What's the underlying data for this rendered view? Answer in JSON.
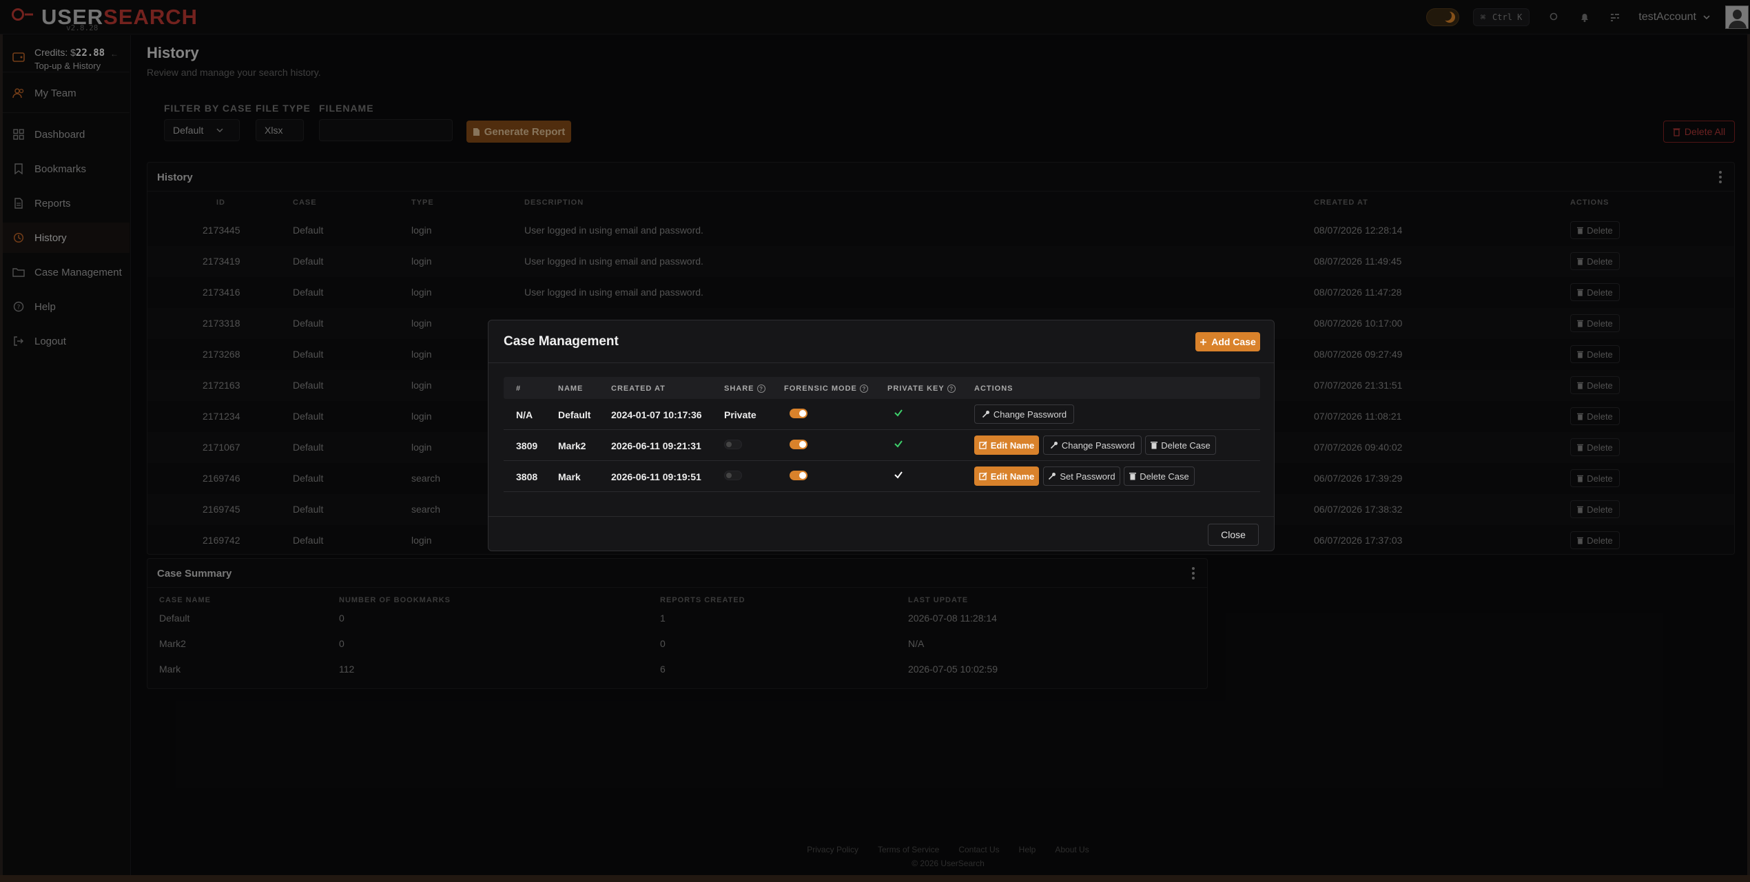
{
  "app": {
    "logo_user": "USER",
    "logo_search": "SEARCH",
    "version": "v2.8.28",
    "shortcut_cmd": "⌘",
    "shortcut_key": "Ctrl K",
    "account_name": "testAccount"
  },
  "sidebar": {
    "credits_label": "Credits: $",
    "credits_value": "22.88",
    "topup_label": "Top-up & History",
    "items": [
      {
        "label": "My Team"
      },
      {
        "label": "Dashboard"
      },
      {
        "label": "Bookmarks"
      },
      {
        "label": "Reports"
      },
      {
        "label": "History"
      },
      {
        "label": "Case Management"
      },
      {
        "label": "Help"
      },
      {
        "label": "Logout"
      }
    ]
  },
  "page": {
    "title": "History",
    "subtitle": "Review and manage your search history."
  },
  "filters": {
    "case_label": "FILTER BY CASE",
    "case_value": "Default",
    "filetype_label": "FILE TYPE",
    "filetype_value": "Xlsx",
    "filename_label": "FILENAME",
    "filename_value": "",
    "generate_label": "Generate Report",
    "delete_all_label": "Delete All"
  },
  "history": {
    "title": "History",
    "columns": [
      "ID",
      "CASE",
      "TYPE",
      "DESCRIPTION",
      "CREATED AT",
      "ACTIONS"
    ],
    "delete_label": "Delete",
    "rows": [
      {
        "id": "2173445",
        "case": "Default",
        "type": "login",
        "description": "User logged in using email and password.",
        "created": "08/07/2026 12:28:14"
      },
      {
        "id": "2173419",
        "case": "Default",
        "type": "login",
        "description": "User logged in using email and password.",
        "created": "08/07/2026 11:49:45"
      },
      {
        "id": "2173416",
        "case": "Default",
        "type": "login",
        "description": "User logged in using email and password.",
        "created": "08/07/2026 11:47:28"
      },
      {
        "id": "2173318",
        "case": "Default",
        "type": "login",
        "description": "",
        "created": "08/07/2026 10:17:00"
      },
      {
        "id": "2173268",
        "case": "Default",
        "type": "login",
        "description": "",
        "created": "08/07/2026 09:27:49"
      },
      {
        "id": "2172163",
        "case": "Default",
        "type": "login",
        "description": "",
        "created": "07/07/2026 21:31:51"
      },
      {
        "id": "2171234",
        "case": "Default",
        "type": "login",
        "description": "",
        "created": "07/07/2026 11:08:21"
      },
      {
        "id": "2171067",
        "case": "Default",
        "type": "login",
        "description": "",
        "created": "07/07/2026 09:40:02"
      },
      {
        "id": "2169746",
        "case": "Default",
        "type": "search",
        "description": "",
        "created": "06/07/2026 17:39:29"
      },
      {
        "id": "2169745",
        "case": "Default",
        "type": "search",
        "description": "",
        "created": "06/07/2026 17:38:32"
      },
      {
        "id": "2169742",
        "case": "Default",
        "type": "login",
        "description": "",
        "created": "06/07/2026 17:37:03"
      }
    ]
  },
  "summary": {
    "title": "Case Summary",
    "columns": [
      "CASE NAME",
      "NUMBER OF BOOKMARKS",
      "REPORTS CREATED",
      "LAST UPDATE"
    ],
    "rows": [
      {
        "name": "Default",
        "bookmarks": "0",
        "reports": "1",
        "last_update": "2026-07-08 11:28:14"
      },
      {
        "name": "Mark2",
        "bookmarks": "0",
        "reports": "0",
        "last_update": "N/A"
      },
      {
        "name": "Mark",
        "bookmarks": "112",
        "reports": "6",
        "last_update": "2026-07-05 10:02:59"
      }
    ]
  },
  "modal": {
    "title": "Case Management",
    "add_label": "Add Case",
    "close_label": "Close",
    "columns": {
      "num": "#",
      "name": "NAME",
      "created": "CREATED AT",
      "share": "SHARE",
      "forensic": "FORENSIC MODE",
      "private_key": "PRIVATE KEY",
      "actions": "ACTIONS"
    },
    "rows": [
      {
        "num": "N/A",
        "name": "Default",
        "created": "2024-01-07 10:17:36",
        "share": "Private",
        "forensic": true,
        "private_key": true,
        "actions": [
          "Change Password"
        ]
      },
      {
        "num": "3809",
        "name": "Mark2",
        "created": "2026-06-11 09:21:31",
        "share": false,
        "forensic": true,
        "private_key": true,
        "actions": [
          "Edit Name",
          "Change Password",
          "Delete Case"
        ]
      },
      {
        "num": "3808",
        "name": "Mark",
        "created": "2026-06-11 09:19:51",
        "share": false,
        "forensic": true,
        "private_key": true,
        "actions": [
          "Edit Name",
          "Set Password",
          "Delete Case"
        ]
      }
    ]
  },
  "footer": {
    "links": [
      "Privacy Policy",
      "Terms of Service",
      "Contact Us",
      "Help",
      "About Us"
    ],
    "copyright": "© 2026 UserSearch"
  },
  "colors": {
    "accent": "#d9822b",
    "danger": "#b83a3a",
    "logo_red": "#c63b35",
    "check_green": "#3ecf6b"
  }
}
